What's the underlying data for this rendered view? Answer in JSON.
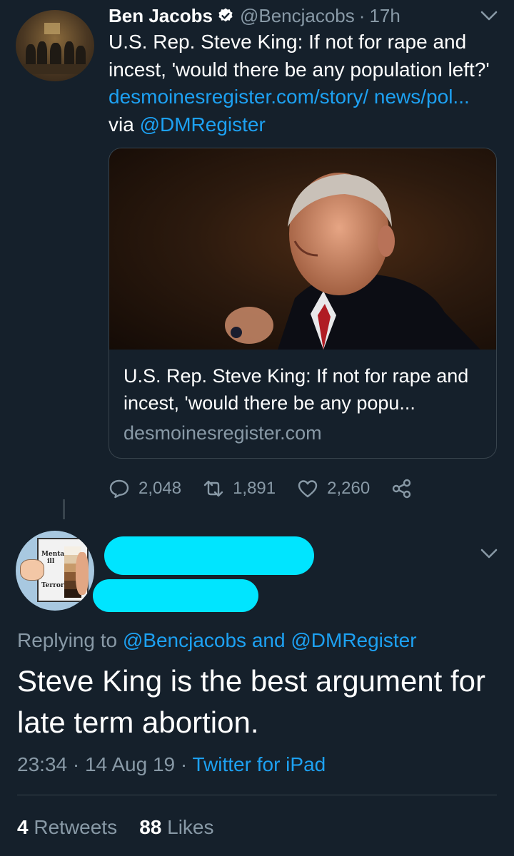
{
  "tweet1": {
    "name": "Ben Jacobs",
    "handle": "@Bencjacobs",
    "separator": "·",
    "time": "17h",
    "text_plain": "U.S. Rep. Steve King: If not for rape and incest, 'would there be any population left?'",
    "link_text": "desmoinesregister.com/story/ news/pol...",
    "via": "via",
    "via_handle": "@DMRegister",
    "icons": {
      "verified": "verified-badge-icon",
      "menu": "chevron-down-icon"
    },
    "card": {
      "title": "U.S. Rep. Steve King: If not for rape and incest, 'would there be any popu...",
      "domain": "desmoinesregister.com"
    },
    "actions": {
      "replies": "2,048",
      "retweets": "1,891",
      "likes": "2,260"
    }
  },
  "tweet2": {
    "avatar_labels": {
      "top": "Mentaly",
      "mid": "ill",
      "bottom": "Terrorist"
    },
    "reply_prefix": "Replying to",
    "reply_handle_1": "@Bencjacobs",
    "reply_and": "and",
    "reply_handle_2": "@DMRegister",
    "text": "Steve King is the best argument for late term abortion.",
    "time": "23:34",
    "separator": "·",
    "date": "14 Aug 19",
    "client": "Twitter for iPad",
    "retweets_count": "4",
    "retweets_label": "Retweets",
    "likes_count": "88",
    "likes_label": "Likes"
  },
  "colors": {
    "background": "#15202b",
    "secondary_text": "#8899a6",
    "link": "#1da1f2",
    "border": "#38444d",
    "redaction": "#00e5ff"
  }
}
